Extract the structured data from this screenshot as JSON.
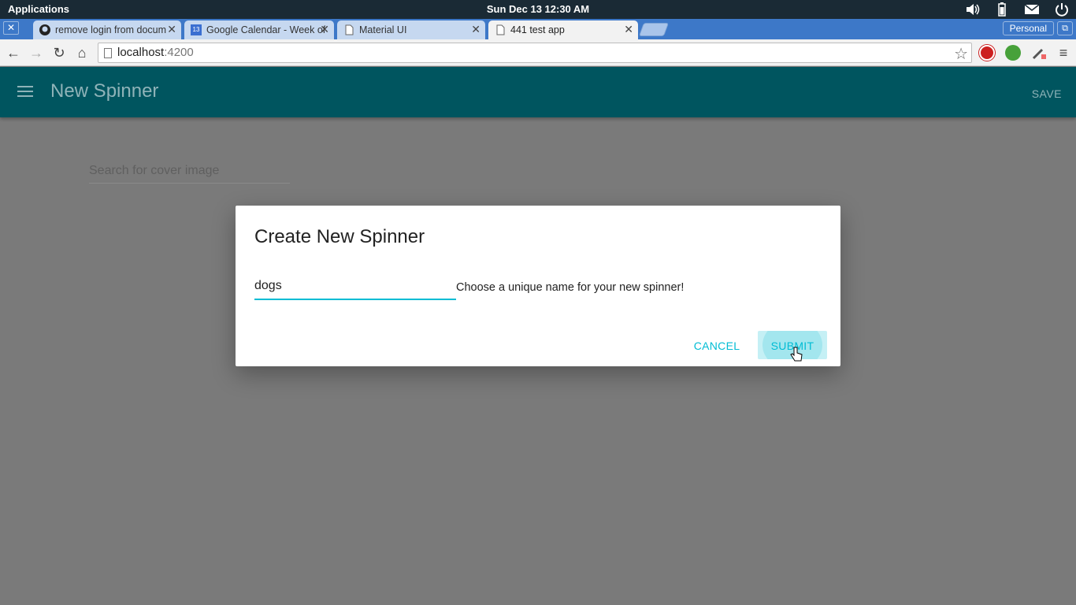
{
  "system_bar": {
    "applications_label": "Applications",
    "clock": "Sun Dec 13 12:30 AM",
    "tray_icons": [
      "volume-icon",
      "battery-icon",
      "mail-icon",
      "power-icon"
    ]
  },
  "browser": {
    "tabs": [
      {
        "title": "remove login from docum",
        "icon": "github-icon"
      },
      {
        "title": "Google Calendar - Week of",
        "icon": "calendar-icon",
        "icon_text": "13"
      },
      {
        "title": "Material UI",
        "icon": "page-icon"
      },
      {
        "title": "441 test app",
        "icon": "page-icon",
        "active": true
      }
    ],
    "profile_label": "Personal",
    "address": {
      "host": "localhost",
      "port": ":4200"
    }
  },
  "app_bar": {
    "title": "New Spinner",
    "save_label": "SAVE",
    "color": "#00555f"
  },
  "background": {
    "search_placeholder": "Search for cover image"
  },
  "dialog": {
    "title": "Create New Spinner",
    "name_value": "dogs",
    "hint": "Choose a unique name for your new spinner!",
    "cancel_label": "CANCEL",
    "submit_label": "SUBMIT",
    "accent": "#00bcd4"
  }
}
